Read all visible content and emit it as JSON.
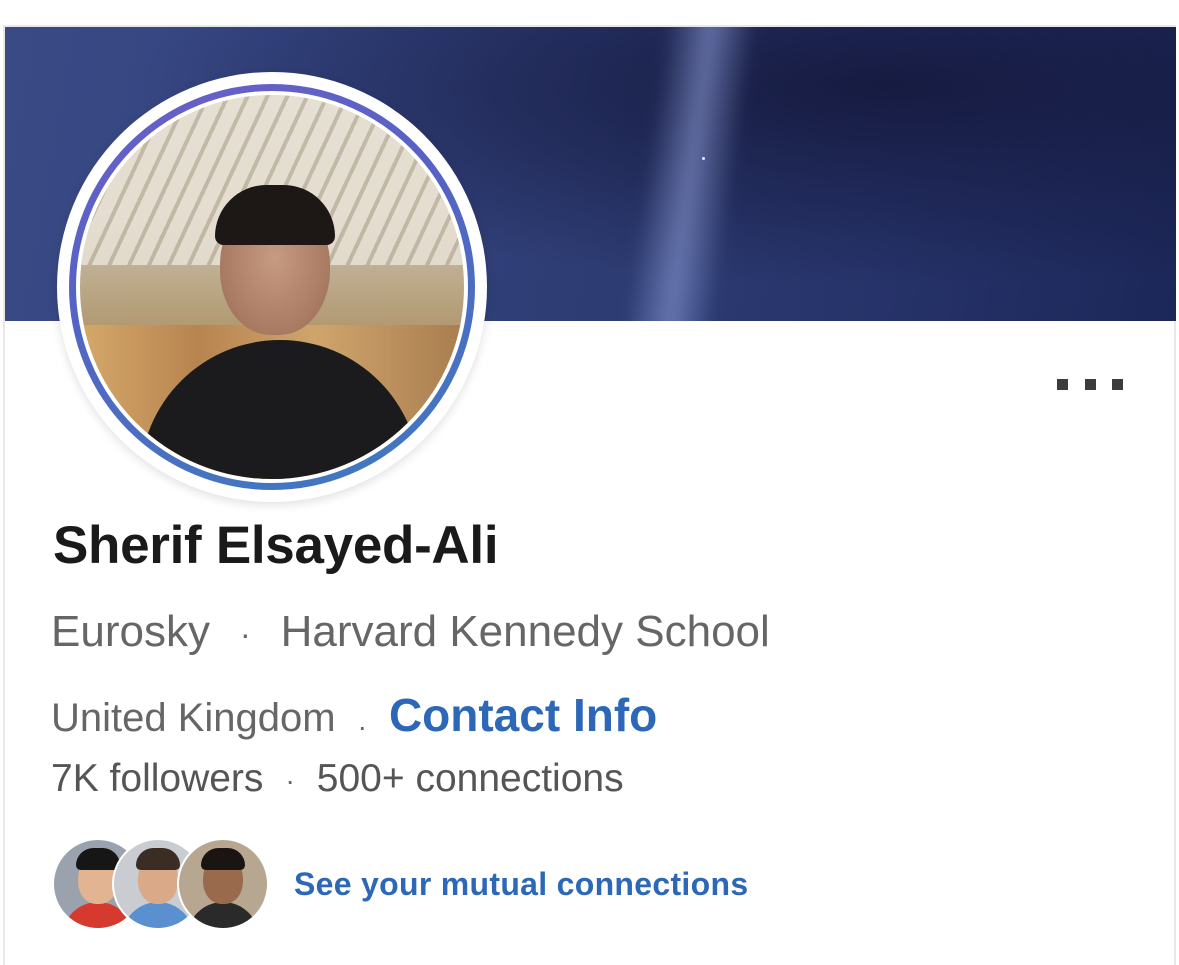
{
  "profile": {
    "name": "Sherif Elsayed-Ali",
    "headline": {
      "company": "Eurosky",
      "separator": "·",
      "school": "Harvard Kennedy School"
    },
    "location": "United Kingdom",
    "location_separator": "·",
    "contact_link": "Contact Info",
    "followers": "7K followers",
    "stats_separator": "·",
    "connections": "500+ connections",
    "mutual_link": "See your mutual connections"
  },
  "icons": {
    "more": "more-options-icon",
    "avatar": "profile-photo",
    "cover": "cover-photo"
  },
  "colors": {
    "link": "#2c68b7",
    "avatar_ring_start": "#6b5fc9",
    "avatar_ring_end": "#3e7bc0",
    "text_primary": "#1a1a1a",
    "text_secondary": "#666666"
  }
}
